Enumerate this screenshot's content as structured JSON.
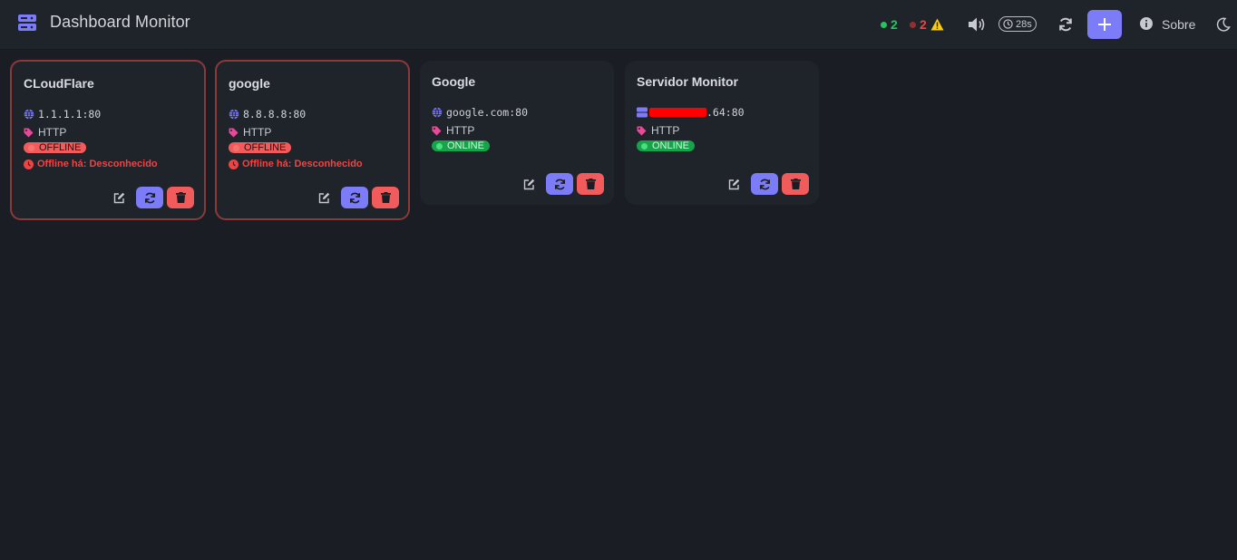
{
  "header": {
    "title": "Dashboard Monitor",
    "online_count": "2",
    "offline_count": "2",
    "timer": "28s",
    "add_label": "+",
    "about_label": "Sobre"
  },
  "colors": {
    "accent": "#7c7cf8",
    "online": "#22c55e",
    "offline": "#ef4444",
    "warning": "#facc15",
    "tag": "#ec4899"
  },
  "cards": [
    {
      "title": "CLoudFlare",
      "address": "1.1.1.1:80",
      "address_icon": "globe-icon",
      "protocol": "HTTP",
      "status": "OFFLINE",
      "since": "Offline há: Desconhecido"
    },
    {
      "title": "google",
      "address": "8.8.8.8:80",
      "address_icon": "globe-icon",
      "protocol": "HTTP",
      "status": "OFFLINE",
      "since": "Offline há: Desconhecido"
    },
    {
      "title": "Google",
      "address": "google.com:80",
      "address_icon": "globe-icon",
      "protocol": "HTTP",
      "status": "ONLINE"
    },
    {
      "title": "Servidor Monitor",
      "address": ".64:80",
      "address_icon": "server-icon",
      "protocol": "HTTP",
      "status": "ONLINE"
    }
  ]
}
